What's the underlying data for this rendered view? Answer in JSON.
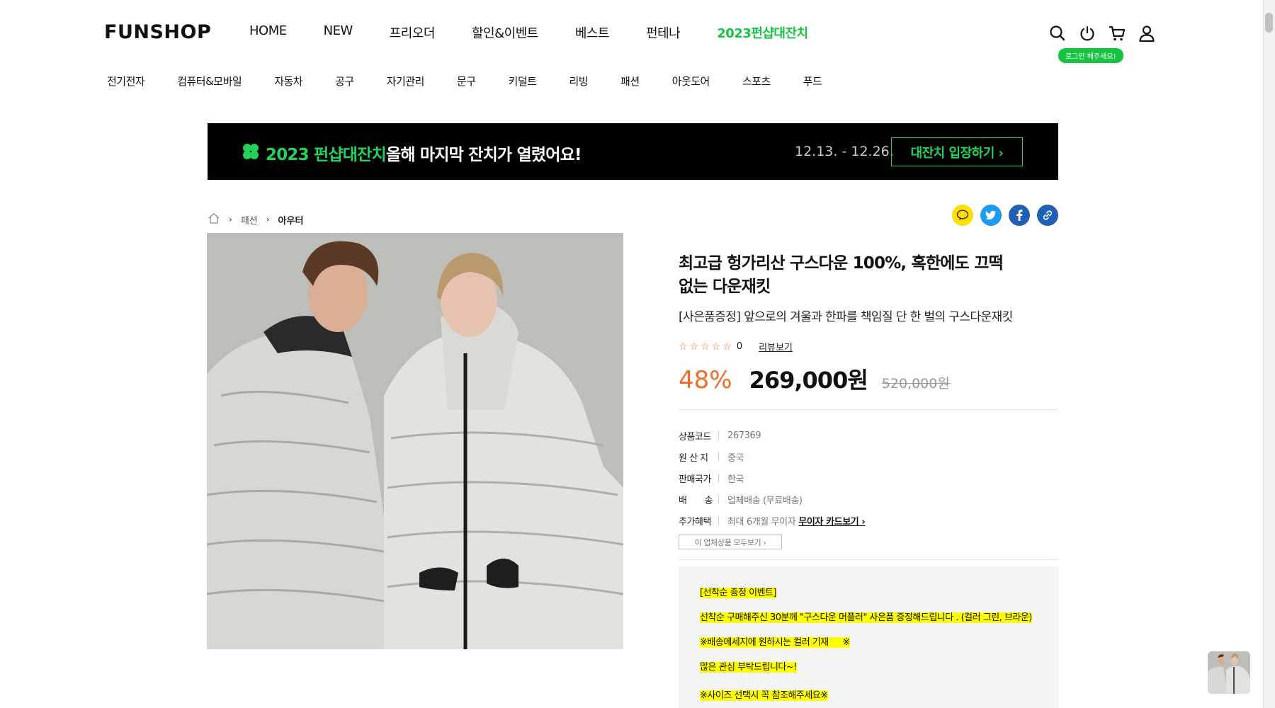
{
  "header": {
    "logo": "FUNSHOP",
    "nav": [
      "HOME",
      "NEW",
      "프리오더",
      "할인&이벤트",
      "베스트",
      "펀테나",
      "2023펀샵대잔치"
    ],
    "highlight_color": "#16c442",
    "login_badge": "로그인 해주세요!",
    "icons": [
      "search-icon",
      "power-icon",
      "cart-icon",
      "user-icon"
    ]
  },
  "categories": [
    "전기전자",
    "컴퓨터&모바일",
    "자동차",
    "공구",
    "자기관리",
    "문구",
    "키덜트",
    "리빙",
    "패션",
    "아웃도어",
    "스포츠",
    "푸드"
  ],
  "banner": {
    "title": "2023 펀샵대잔치",
    "subtitle": "올해 마지막 잔치가 열렸어요!",
    "date": "12.13. - 12.26.",
    "button": "대잔치 입장하기 ›",
    "accent": "#22d35a"
  },
  "breadcrumb": {
    "items": [
      "패션",
      "아우터"
    ]
  },
  "share_icons": [
    "kakao-icon",
    "twitter-icon",
    "facebook-icon",
    "link-icon"
  ],
  "product": {
    "title": "최고급 헝가리산 구스다운 100%, 혹한에도 끄떡없는 다운재킷",
    "subtitle": "[사은품증정] 앞으로의 겨울과 한파를 책임질 단 한 벌의 구스다운재킷",
    "rating_count": "0",
    "review_link": "리뷰보기",
    "discount_rate": "48%",
    "price": "269,000원",
    "original_price": "520,000원",
    "info": [
      {
        "key": "상품코드",
        "value": "267369"
      },
      {
        "key": "원 산 지",
        "value": "중국"
      },
      {
        "key": "판매국가",
        "value": "한국"
      },
      {
        "key": "배　　송",
        "value": "업체배송 (무료배송)"
      },
      {
        "key": "추가혜택",
        "value": "최대 6개월 무이자",
        "link": "무이자 카드보기 ›"
      }
    ],
    "vendor_button": "이 업체상품 모두보기 ›"
  },
  "event_notice": [
    "[선착순 증정 이벤트]",
    "선착순 구매해주신 30분께 \"구스다운 머플러\" 사은품 증정해드립니다 . (컬러 그린, 브라운)",
    "※배송메세지에 원하시는 컬러 기재 　 ※",
    "많은 관심 부탁드립니다~!",
    "※사이즈 선택시 꼭 참조해주세요※"
  ],
  "colors": {
    "discount": "#f26a2a",
    "highlight_bg": "#ffff00"
  }
}
